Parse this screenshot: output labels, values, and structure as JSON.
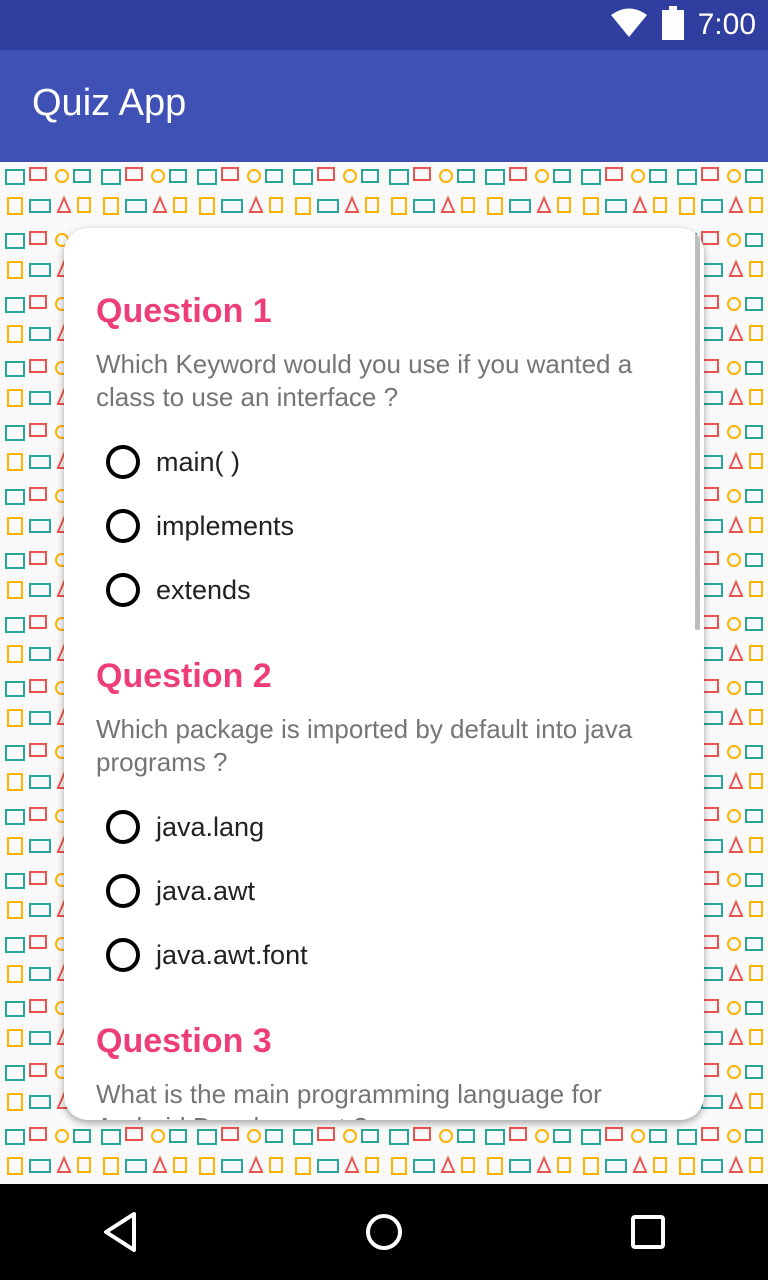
{
  "status_bar": {
    "time": "7:00",
    "icons": [
      "wifi-icon",
      "battery-icon"
    ]
  },
  "app_bar": {
    "title": "Quiz App"
  },
  "colors": {
    "status_bar": "#303f9f",
    "app_bar": "#3f51b5",
    "question_title": "#ee3e7a",
    "question_text": "#757575"
  },
  "questions": [
    {
      "title": "Question 1",
      "text": "Which Keyword would you use if you wanted a class to use an interface ?",
      "options": [
        "main( )",
        "implements",
        "extends"
      ]
    },
    {
      "title": "Question 2",
      "text": "Which package is imported by default into java programs ?",
      "options": [
        "java.lang",
        "java.awt",
        "java.awt.font"
      ]
    },
    {
      "title": "Question 3",
      "text": "What is the main programming language for Android Development ?",
      "options": []
    }
  ],
  "nav_bar": {
    "icons": [
      "back-icon",
      "home-icon",
      "recents-icon"
    ]
  }
}
